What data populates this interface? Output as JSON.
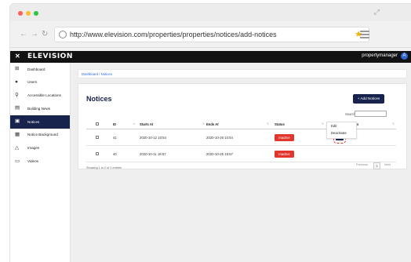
{
  "browser": {
    "url": "http://www.elevision.com/properties/properties/notices/add-notices"
  },
  "app": {
    "logo": "ELEVISION",
    "user": "propertymanager",
    "avatar_initial": "A"
  },
  "sidebar": {
    "items": [
      {
        "label": "Dashboard",
        "icon": "grid-icon"
      },
      {
        "label": "Users",
        "icon": "user-icon"
      },
      {
        "label": "Accessible Locations",
        "icon": "location-pin-icon"
      },
      {
        "label": "Building News",
        "icon": "newspaper-icon"
      },
      {
        "label": "Notices",
        "icon": "notice-icon",
        "active": true
      },
      {
        "label": "Notice Background",
        "icon": "image-stack-icon"
      },
      {
        "label": "Images",
        "icon": "image-icon"
      },
      {
        "label": "Videos",
        "icon": "video-icon"
      }
    ]
  },
  "breadcrumb": "Dashboard / Notices",
  "page": {
    "title": "Notices",
    "add_button": "+ Add Notices",
    "search_label": "Search:"
  },
  "table": {
    "columns": [
      "ID",
      "Starts At",
      "Ends At",
      "Status",
      "Actions"
    ],
    "rows": [
      {
        "id": "41",
        "starts_at": "2020-10-12 10:54",
        "ends_at": "2020-10-26 10:54",
        "status": "Inactive"
      },
      {
        "id": "40",
        "starts_at": "2020-10-11 18:57",
        "ends_at": "2020-10-25 18:57",
        "status": "Inactive"
      }
    ]
  },
  "action_menu": {
    "items": [
      "Edit",
      "Deactivate"
    ]
  },
  "footer": {
    "info": "Showing 1 to 2 of 2 entries",
    "previous": "Previous",
    "page": "1",
    "next": "Next"
  },
  "colors": {
    "navy": "#17224d",
    "danger": "#e0362c",
    "link": "#2f66d6"
  }
}
